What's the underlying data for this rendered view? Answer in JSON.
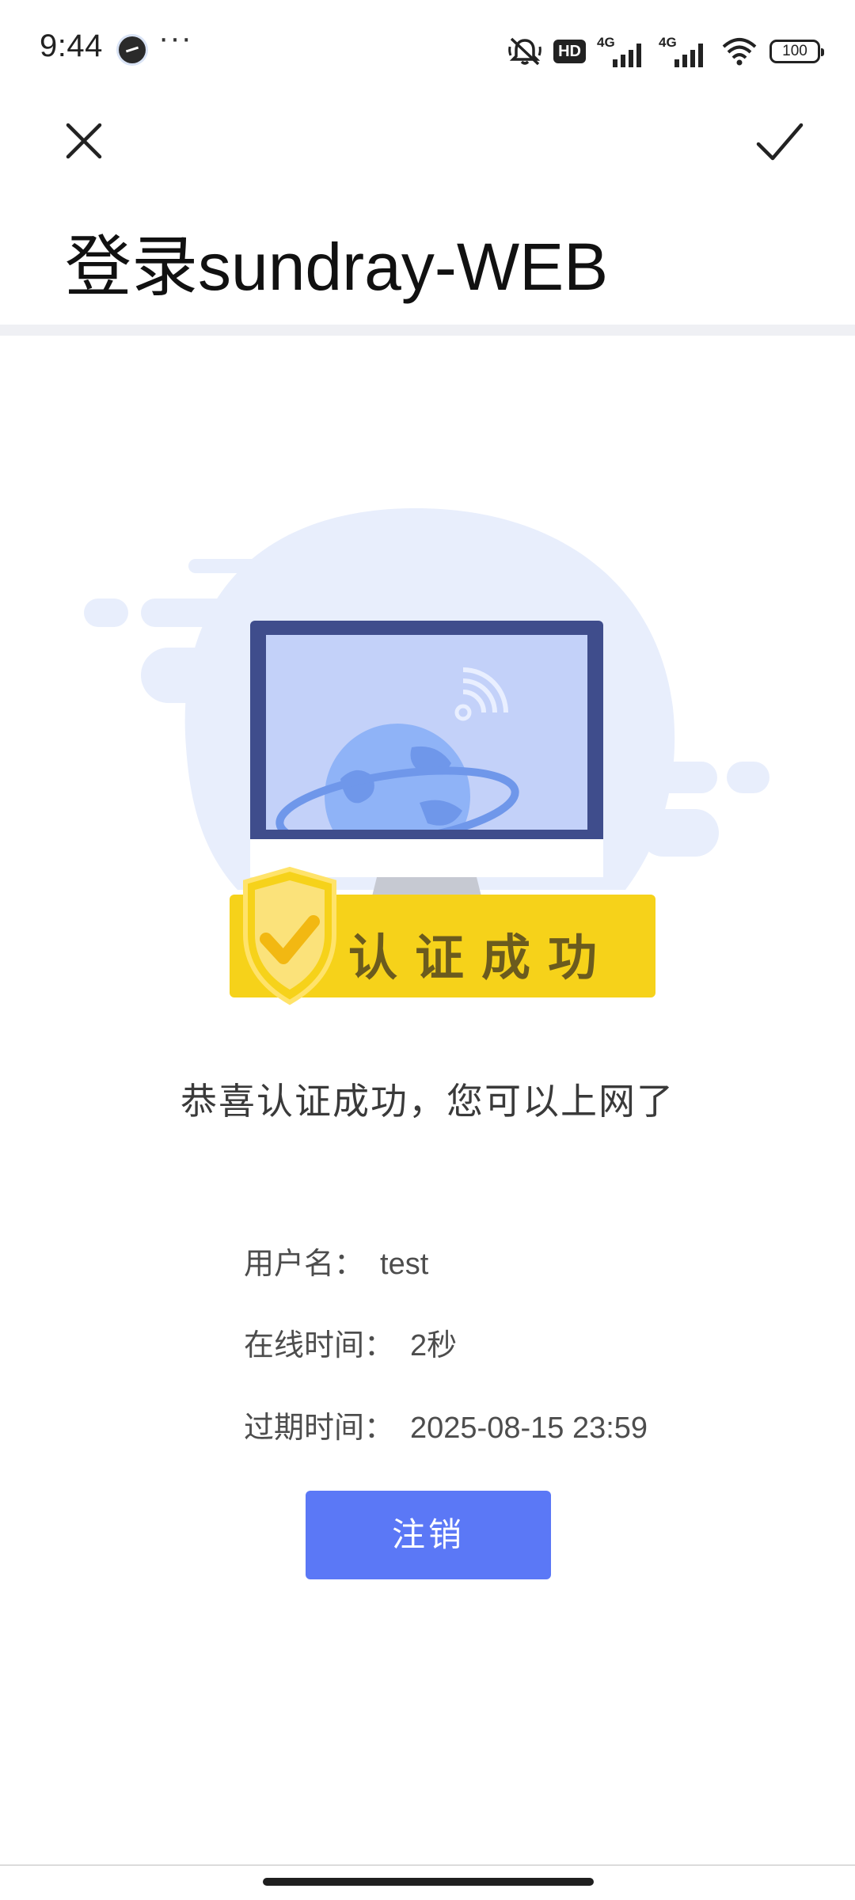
{
  "status_bar": {
    "time": "9:44",
    "more": "···",
    "hd_badge": "HD",
    "signal_1_label": "4G",
    "signal_2_label": "4G",
    "battery": "100",
    "icons": [
      "mute-icon",
      "hd-icon",
      "signal-icon",
      "signal-icon",
      "wifi-icon",
      "battery-icon"
    ]
  },
  "header": {
    "title": "登录sundray-WEB",
    "close_icon": "close-icon",
    "confirm_icon": "check-icon"
  },
  "illustration": {
    "badge_text": "认证成功",
    "colors": {
      "background_blob": "#e8eefc",
      "monitor_frame": "#3f4d8c",
      "screen": "#c3d1f9",
      "globe": "#8fb3f7",
      "badge": "#f6d21a"
    }
  },
  "message": "恭喜认证成功，您可以上网了",
  "info": {
    "username_label": "用户名：",
    "username_value": "test",
    "online_label": "在线时间：",
    "online_value": "2秒",
    "expire_label": "过期时间：",
    "expire_value": "2025-08-15 23:59"
  },
  "actions": {
    "logout_label": "注销",
    "logout_color": "#5b78f6"
  }
}
